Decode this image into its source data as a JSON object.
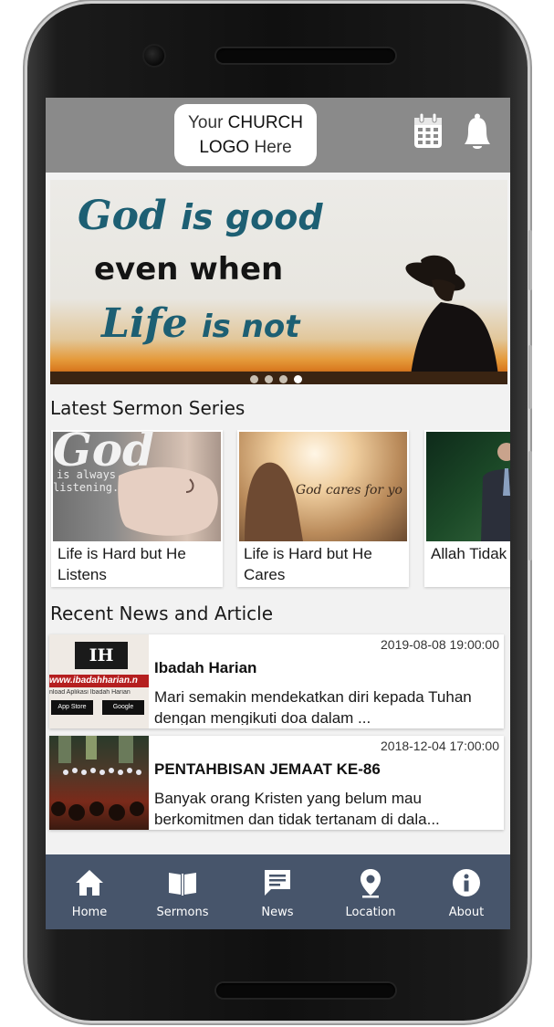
{
  "header": {
    "logo": {
      "part1": "Your",
      "part2": "CHURCH",
      "part3": "LOGO",
      "part4": "Here"
    },
    "icons": [
      "calendar-icon",
      "bell-icon"
    ]
  },
  "banner": {
    "line1_word1": "God",
    "line1_word2": "is good",
    "line2": "even when",
    "line3_word1": "Life",
    "line3_word2": "is not",
    "slides": 4,
    "active_slide": 4
  },
  "sermons": {
    "title": "Latest Sermon Series",
    "cards": [
      {
        "title": "Life is Hard but He Listens",
        "img_text1": "God",
        "img_text2": "is always",
        "img_text3": "listening."
      },
      {
        "title": "Life is Hard but He Cares",
        "img_text1": "God cares for yo"
      },
      {
        "title": "Allah Tidak Berhenti M"
      }
    ]
  },
  "news": {
    "title": "Recent News and Article",
    "items": [
      {
        "date": "2019-08-08 19:00:00",
        "title": "Ibadah Harian",
        "desc": "Mari semakin mendekatkan diri kepada Tuhan dengan mengikuti doa dalam ...",
        "thumb_logo": "IH",
        "thumb_url": "www.ibadahharian.n",
        "thumb_caption": "nload Aplikasi Ibadah Harian",
        "thumb_appstore": "App Store",
        "thumb_google": "Google"
      },
      {
        "date": "2018-12-04 17:00:00",
        "title": "PENTAHBISAN JEMAAT KE-86",
        "desc": "Banyak orang Kristen yang belum mau berkomitmen dan tidak tertanam di dala..."
      }
    ]
  },
  "nav": [
    {
      "label": "Home",
      "icon": "home-icon"
    },
    {
      "label": "Sermons",
      "icon": "book-icon"
    },
    {
      "label": "News",
      "icon": "chat-icon"
    },
    {
      "label": "Location",
      "icon": "location-pin-icon"
    },
    {
      "label": "About",
      "icon": "info-icon"
    }
  ],
  "colors": {
    "topbar": "#8a8a8a",
    "bottomnav": "#47556b",
    "banner_text": "#1d5f73"
  }
}
